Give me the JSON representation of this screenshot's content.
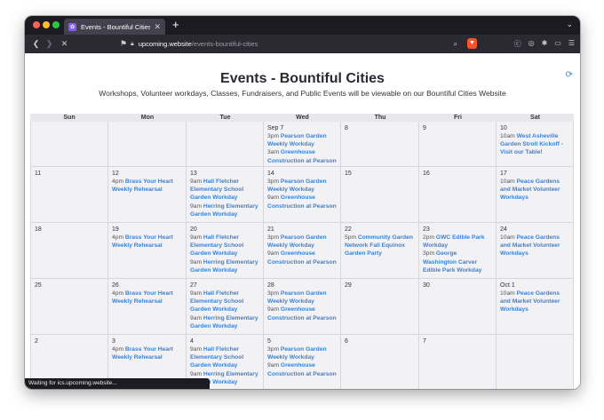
{
  "browser": {
    "tab_title": "Events - Bountiful Cities",
    "url_host": "upcoming.website",
    "url_path": "/events-bountiful-cities",
    "status_text": "Waiting for ics.upcoming.website..."
  },
  "page": {
    "title": "Events - Bountiful Cities",
    "subtitle": "Workshops, Volunteer workdays, Classes, Fundraisers, and Public Events will be viewable on our Bountiful Cities Website"
  },
  "calendar": {
    "weekdays": [
      "Sun",
      "Mon",
      "Tue",
      "Wed",
      "Thu",
      "Fri",
      "Sat"
    ],
    "weeks": [
      [
        {
          "day": "",
          "events": []
        },
        {
          "day": "",
          "events": []
        },
        {
          "day": "",
          "events": []
        },
        {
          "day": "Sep 7",
          "events": [
            {
              "time": "3pm",
              "name": "Pearson Garden Weekly Workday"
            },
            {
              "time": "3am",
              "name": "Greenhouse Construction at Pearson"
            }
          ]
        },
        {
          "day": "8",
          "events": []
        },
        {
          "day": "9",
          "events": []
        },
        {
          "day": "10",
          "events": [
            {
              "time": "10am",
              "name": "West Asheville Garden Stroll Kickoff - Visit our Table!"
            }
          ]
        }
      ],
      [
        {
          "day": "11",
          "events": []
        },
        {
          "day": "12",
          "events": [
            {
              "time": "4pm",
              "name": "Brass Your Heart Weekly Rehearsal"
            }
          ]
        },
        {
          "day": "13",
          "events": [
            {
              "time": "9am",
              "name": "Hall Fletcher Elementary School Garden Workday"
            },
            {
              "time": "9am",
              "name": "Herring Elementary Garden Workday"
            }
          ]
        },
        {
          "day": "14",
          "events": [
            {
              "time": "3pm",
              "name": "Pearson Garden Weekly Workday"
            },
            {
              "time": "9am",
              "name": "Greenhouse Construction at Pearson"
            }
          ]
        },
        {
          "day": "15",
          "events": []
        },
        {
          "day": "16",
          "events": []
        },
        {
          "day": "17",
          "events": [
            {
              "time": "10am",
              "name": "Peace Gardens and Market Volunteer Workdays"
            }
          ]
        }
      ],
      [
        {
          "day": "18",
          "events": []
        },
        {
          "day": "19",
          "events": [
            {
              "time": "4pm",
              "name": "Brass Your Heart Weekly Rehearsal"
            }
          ]
        },
        {
          "day": "20",
          "events": [
            {
              "time": "9am",
              "name": "Hall Fletcher Elementary School Garden Workday"
            },
            {
              "time": "9am",
              "name": "Herring Elementary Garden Workday"
            }
          ]
        },
        {
          "day": "21",
          "events": [
            {
              "time": "3pm",
              "name": "Pearson Garden Weekly Workday"
            },
            {
              "time": "9am",
              "name": "Greenhouse Construction at Pearson"
            }
          ]
        },
        {
          "day": "22",
          "events": [
            {
              "time": "5pm",
              "name": "Community Garden Network Fall Equinox Garden Party"
            }
          ]
        },
        {
          "day": "23",
          "events": [
            {
              "time": "2pm",
              "name": "GWC Edible Park Workday"
            },
            {
              "time": "3pm",
              "name": "George Washington Carver Edible Park Workday"
            }
          ]
        },
        {
          "day": "24",
          "events": [
            {
              "time": "10am",
              "name": "Peace Gardens and Market Volunteer Workdays"
            }
          ]
        }
      ],
      [
        {
          "day": "25",
          "events": []
        },
        {
          "day": "26",
          "events": [
            {
              "time": "4pm",
              "name": "Brass Your Heart Weekly Rehearsal"
            }
          ]
        },
        {
          "day": "27",
          "events": [
            {
              "time": "9am",
              "name": "Hall Fletcher Elementary School Garden Workday"
            },
            {
              "time": "9am",
              "name": "Herring Elementary Garden Workday"
            }
          ]
        },
        {
          "day": "28",
          "events": [
            {
              "time": "3pm",
              "name": "Pearson Garden Weekly Workday"
            },
            {
              "time": "9am",
              "name": "Greenhouse Construction at Pearson"
            }
          ]
        },
        {
          "day": "29",
          "events": []
        },
        {
          "day": "30",
          "events": []
        },
        {
          "day": "Oct 1",
          "events": [
            {
              "time": "10am",
              "name": "Peace Gardens and Market Volunteer Workdays"
            }
          ]
        }
      ],
      [
        {
          "day": "2",
          "events": []
        },
        {
          "day": "3",
          "events": [
            {
              "time": "4pm",
              "name": "Brass Your Heart Weekly Rehearsal"
            }
          ]
        },
        {
          "day": "4",
          "events": [
            {
              "time": "9am",
              "name": "Hall Fletcher Elementary School Garden Workday"
            },
            {
              "time": "9am",
              "name": "Herring Elementary Garden Workday"
            }
          ]
        },
        {
          "day": "5",
          "events": [
            {
              "time": "3pm",
              "name": "Pearson Garden Weekly Workday"
            },
            {
              "time": "9am",
              "name": "Greenhouse Construction at Pearson"
            }
          ]
        },
        {
          "day": "6",
          "events": []
        },
        {
          "day": "7",
          "events": []
        },
        {
          "day": "",
          "events": []
        }
      ]
    ]
  },
  "colors": {
    "event_link": "#3a82d6",
    "cell_bg": "#f2f2f5",
    "tabbar_bg": "#1c1b22"
  }
}
